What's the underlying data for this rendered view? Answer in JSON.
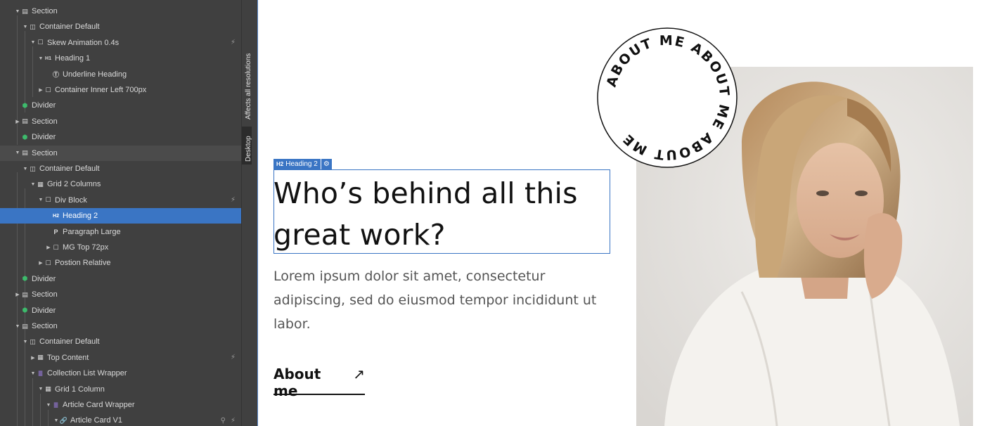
{
  "navigator": {
    "items": [
      {
        "label": "Section",
        "icon": "section-icon",
        "indent": 0,
        "caret": "down"
      },
      {
        "label": "Container Default",
        "icon": "container-icon",
        "indent": 1,
        "caret": "down"
      },
      {
        "label": "Skew Animation 0.4s",
        "icon": "div-block-icon",
        "indent": 2,
        "caret": "down",
        "bolt": true
      },
      {
        "label": "Heading 1",
        "icon": "h1-icon",
        "indent": 3,
        "caret": "down"
      },
      {
        "label": "Underline Heading",
        "icon": "text-block-icon",
        "indent": 4,
        "caret": ""
      },
      {
        "label": "Container Inner Left 700px",
        "icon": "div-block-icon",
        "indent": 3,
        "caret": "right"
      },
      {
        "label": "Divider",
        "icon": "component-icon",
        "indent": 0,
        "caret": ""
      },
      {
        "label": "Section",
        "icon": "section-icon",
        "indent": 0,
        "caret": "right"
      },
      {
        "label": "Divider",
        "icon": "component-icon",
        "indent": 0,
        "caret": ""
      },
      {
        "label": "Section",
        "icon": "section-icon",
        "indent": 0,
        "caret": "down",
        "highlight": true
      },
      {
        "label": "Container Default",
        "icon": "container-icon",
        "indent": 1,
        "caret": "down"
      },
      {
        "label": "Grid 2 Columns",
        "icon": "grid-icon",
        "indent": 2,
        "caret": "down"
      },
      {
        "label": "Div Block",
        "icon": "div-block-icon",
        "indent": 3,
        "caret": "down",
        "bolt": true
      },
      {
        "label": "Heading 2",
        "icon": "h2-icon",
        "indent": 4,
        "caret": "",
        "selected": true
      },
      {
        "label": "Paragraph Large",
        "icon": "paragraph-icon",
        "indent": 4,
        "caret": ""
      },
      {
        "label": "MG Top 72px",
        "icon": "div-block-icon",
        "indent": 4,
        "caret": "right"
      },
      {
        "label": "Postion Relative",
        "icon": "div-block-icon",
        "indent": 3,
        "caret": "right"
      },
      {
        "label": "Divider",
        "icon": "component-icon",
        "indent": 0,
        "caret": ""
      },
      {
        "label": "Section",
        "icon": "section-icon",
        "indent": 0,
        "caret": "right"
      },
      {
        "label": "Divider",
        "icon": "component-icon",
        "indent": 0,
        "caret": ""
      },
      {
        "label": "Section",
        "icon": "section-icon",
        "indent": 0,
        "caret": "down"
      },
      {
        "label": "Container Default",
        "icon": "container-icon",
        "indent": 1,
        "caret": "down"
      },
      {
        "label": "Top Content",
        "icon": "grid-icon",
        "indent": 2,
        "caret": "right",
        "bolt": true
      },
      {
        "label": "Collection List Wrapper",
        "icon": "collection-icon",
        "indent": 2,
        "caret": "down"
      },
      {
        "label": "Grid 1 Column",
        "icon": "grid-icon",
        "indent": 3,
        "caret": "down"
      },
      {
        "label": "Article Card Wrapper",
        "icon": "collection-item-icon",
        "indent": 4,
        "caret": "down"
      },
      {
        "label": "Article Card V1",
        "icon": "link-block-icon",
        "indent": 5,
        "caret": "down",
        "bolt": true,
        "pin": true
      }
    ],
    "colors": {
      "panel": "#404040",
      "selected": "#3a75c4",
      "component": "#3dbb6c",
      "collection": "#9b7be0"
    }
  },
  "breakpoint_strip": {
    "note_label": "Affects all resolutions",
    "device_label": "Desktop"
  },
  "canvas": {
    "selection_tag": {
      "icon": "h2-icon",
      "label": "Heading 2",
      "settings_icon": "gear-icon"
    },
    "heading": "Who’s behind all this great work?",
    "paragraph": "Lorem ipsum dolor sit amet, consectetur adipiscing, sed do eiusmod tempor incididunt ut labor.",
    "link": {
      "label": "About me",
      "icon": "arrow-up-right-icon"
    },
    "badge_text": "ABOUT ME ABOUT ME ABOUT ME",
    "photo": {
      "icon": "portrait-photo"
    }
  }
}
